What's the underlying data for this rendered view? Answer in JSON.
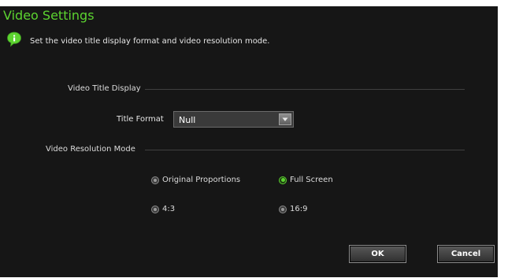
{
  "window": {
    "title": "Video Settings"
  },
  "info": {
    "icon": "info-bubble-icon",
    "text": "Set the video title display format and video resolution mode."
  },
  "title_display": {
    "section_label": "Video Title Display",
    "field_label": "Title Format",
    "select_value": "Null"
  },
  "resolution": {
    "section_label": "Video Resolution Mode",
    "options": [
      {
        "label": "Original Proportions",
        "checked": false
      },
      {
        "label": "Full Screen",
        "checked": true
      },
      {
        "label": "4:3",
        "checked": false
      },
      {
        "label": "16:9",
        "checked": false
      }
    ]
  },
  "buttons": {
    "ok": "OK",
    "cancel": "Cancel"
  },
  "colors": {
    "accent": "#5cd430",
    "background": "#161616"
  }
}
